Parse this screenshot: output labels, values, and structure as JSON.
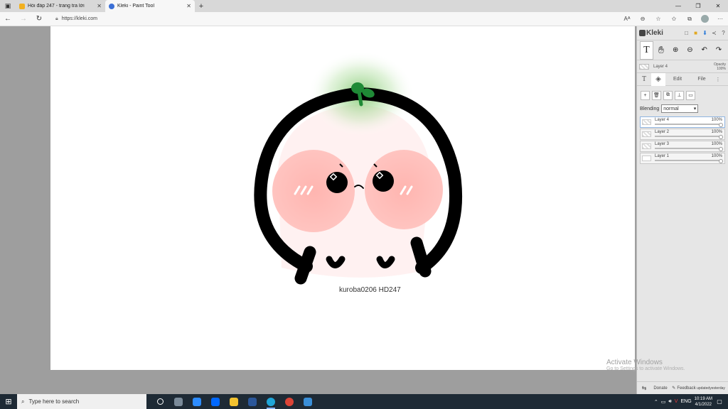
{
  "browser": {
    "tabs": [
      {
        "title": "Hỏi đáp 247 - trang tra lời",
        "active": false,
        "favicon_color": "#f2b01e"
      },
      {
        "title": "Kleki - Paint Tool",
        "active": true,
        "favicon_color": "#3b6fd6"
      }
    ],
    "url": "https://kleki.com"
  },
  "canvas": {
    "signature": "kuroba0206 HD247"
  },
  "app": {
    "logo": "Kleki",
    "current_layer": "Layer 4",
    "opacity_label": "Opacity",
    "opacity_value": "100%",
    "subtabs": {
      "edit": "Edit",
      "file": "File"
    },
    "blending_label": "Blending",
    "blending_value": "normal",
    "layers": [
      {
        "name": "Layer 4",
        "opacity": "100%",
        "selected": true
      },
      {
        "name": "Layer 2",
        "opacity": "100%",
        "selected": false
      },
      {
        "name": "Layer 3",
        "opacity": "100%",
        "selected": false
      },
      {
        "name": "Layer 1",
        "opacity": "100%",
        "selected": false
      }
    ],
    "footer": {
      "donate": "Donate",
      "feedback": "Feedback",
      "updated_line1": "updated",
      "updated_line2": "yesterday"
    }
  },
  "watermark": {
    "line1": "Activate Windows",
    "line2": "Go to Settings to activate Windows."
  },
  "taskbar": {
    "search_placeholder": "Type here to search",
    "lang": "ENG",
    "time": "10:19 AM",
    "date": "4/1/2022",
    "apps": [
      {
        "name": "task-view",
        "color": "#ffffff",
        "running": false
      },
      {
        "name": "app-1",
        "color": "#7a8a99",
        "running": false
      },
      {
        "name": "zoom",
        "color": "#2d8cff",
        "running": false
      },
      {
        "name": "zalo",
        "color": "#0068ff",
        "running": false
      },
      {
        "name": "file-explorer",
        "color": "#f2c230",
        "running": false
      },
      {
        "name": "word",
        "color": "#2b579a",
        "running": false
      },
      {
        "name": "edge",
        "color": "#1fa6d8",
        "running": true
      },
      {
        "name": "chrome",
        "color": "#db4437",
        "running": false
      },
      {
        "name": "photos",
        "color": "#3a8fd8",
        "running": false
      }
    ]
  }
}
